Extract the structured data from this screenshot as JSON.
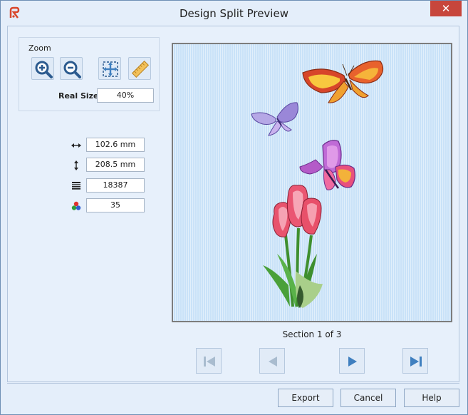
{
  "window": {
    "title": "Design Split Preview",
    "close_glyph": "✕"
  },
  "zoom": {
    "label": "Zoom",
    "real_size_label": "Real Size",
    "real_size_value": "40%"
  },
  "toolbar_icons": [
    "zoom-in-icon",
    "zoom-out-icon",
    "fit-to-window-icon",
    "ruler-icon"
  ],
  "stats": [
    {
      "icon": "width-arrows-icon",
      "value": "102.6 mm"
    },
    {
      "icon": "height-arrows-icon",
      "value": "208.5 mm"
    },
    {
      "icon": "stitches-icon",
      "value": "18387"
    },
    {
      "icon": "colors-icon",
      "value": "35"
    }
  ],
  "section": {
    "label": "Section 1 of 3"
  },
  "nav": {
    "first": {
      "icon": "first-section-icon",
      "enabled": false
    },
    "prev": {
      "icon": "previous-section-icon",
      "enabled": false
    },
    "next": {
      "icon": "next-section-icon",
      "enabled": true
    },
    "last": {
      "icon": "last-section-icon",
      "enabled": true
    }
  },
  "buttons": {
    "export": "Export",
    "cancel": "Cancel",
    "help": "Help"
  },
  "colors": {
    "accent": "#3f7fbf",
    "disabled": "#a9bccf",
    "close": "#c7463c",
    "preview_bg": "#c9e2f8"
  }
}
